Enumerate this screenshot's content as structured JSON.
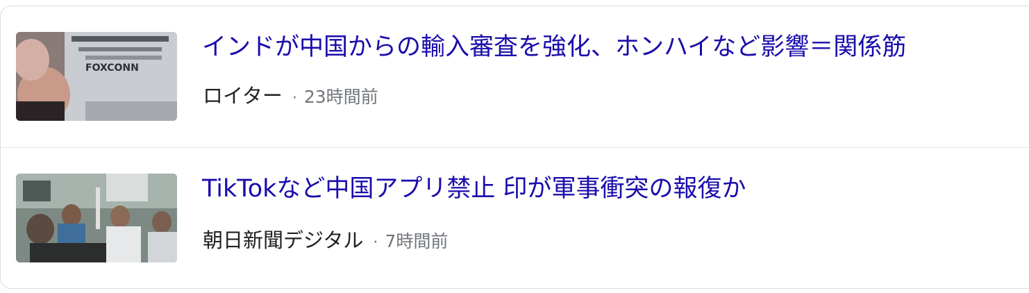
{
  "news": [
    {
      "headline": "インドが中国からの輸入審査を強化、ホンハイなど影響＝関係筋",
      "source": "ロイター",
      "separator": "·",
      "time": "23時間前",
      "thumb_sign_text": "FOXCONN"
    },
    {
      "headline": "TikTokなど中国アプリ禁止 印が軍事衝突の報復か",
      "source": "朝日新聞デジタル",
      "separator": "·",
      "time": "7時間前"
    }
  ],
  "colors": {
    "headline": "#1a0dab",
    "source": "#202124",
    "meta": "#70757a",
    "border": "#dadce0"
  }
}
